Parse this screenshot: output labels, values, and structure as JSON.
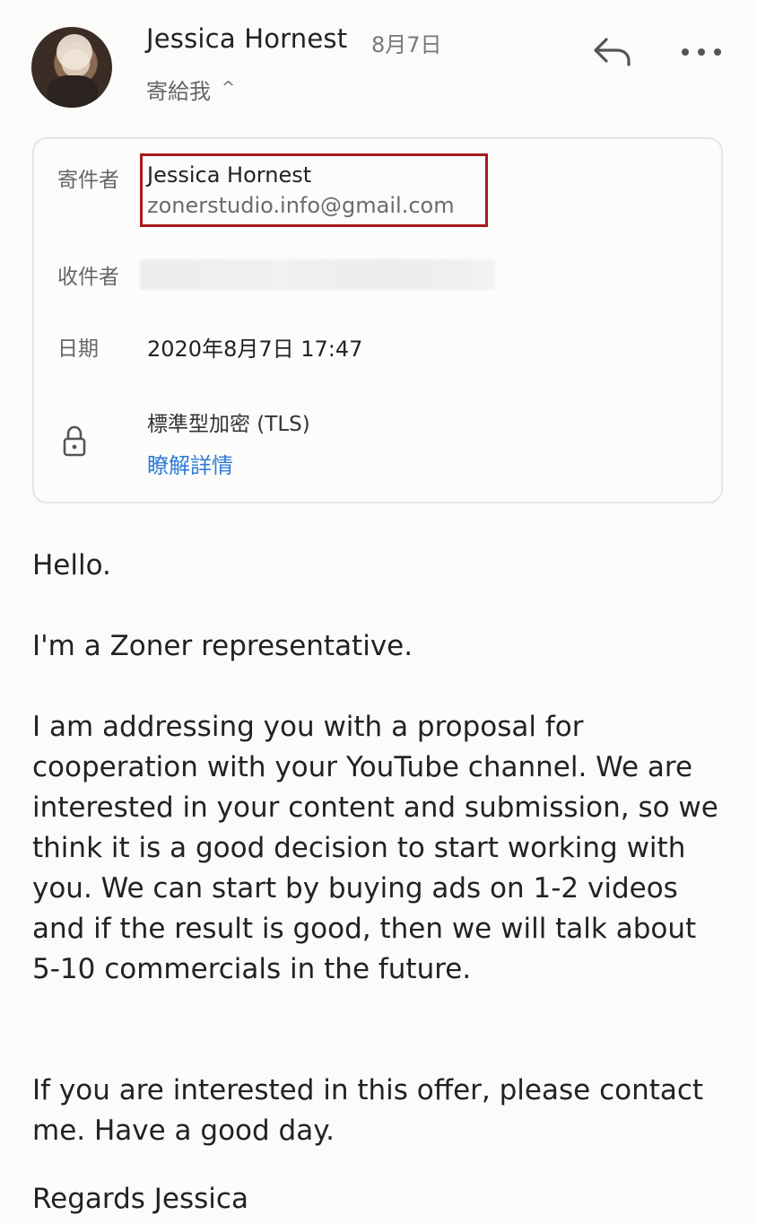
{
  "header": {
    "sender_name": "Jessica Hornest",
    "date_short": "8月7日",
    "to_me_label": "寄給我",
    "to_me_chevron": "^"
  },
  "details": {
    "from_label": "寄件者",
    "from_name": "Jessica Hornest",
    "from_email": "zonerstudio.info@gmail.com",
    "to_label": "收件者",
    "date_label": "日期",
    "date_value": "2020年8月7日 17:47",
    "encryption_value": "標準型加密 (TLS)",
    "encryption_link": "瞭解詳情"
  },
  "body": {
    "p1": "Hello.",
    "p2": "I'm a Zoner representative.",
    "p3": "I am addressing you with a proposal for cooperation with your YouTube channel. We are interested in your content and submission, so we think it is a good decision to start working with you. We can start by buying ads on 1-2 videos and if the result is good, then we will talk about 5-10 commercials in the future.",
    "p4": "If you are interested in this offer, please contact me. Have a good day.",
    "p5": "Regards Jessica"
  },
  "colors": {
    "highlight_border": "#a8191b",
    "link": "#2f7bd9"
  },
  "icons": {
    "reply": "reply-icon",
    "more": "more-icon",
    "lock": "lock-icon",
    "chevron": "chevron-up-icon"
  }
}
